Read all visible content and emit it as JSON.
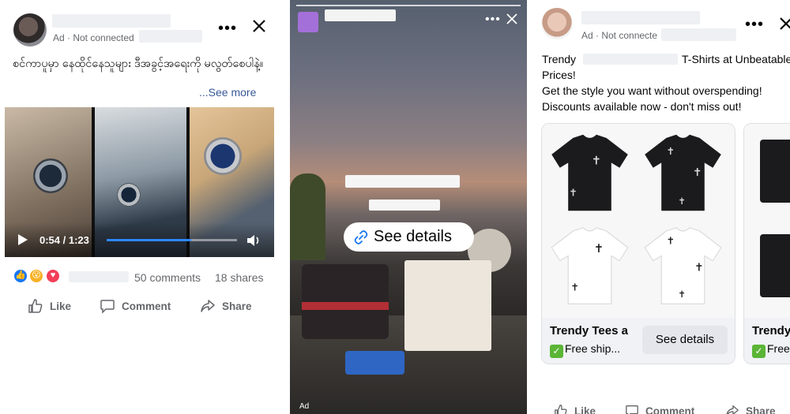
{
  "left_post": {
    "ad_label": "Ad · Not connected",
    "caption": "စင်ကာပူမှာ နေထိုင်နေသူများ ဒီအခွင့်အရေးကို မလွတ်စေပါနဲ့။",
    "see_more": "...See more",
    "video": {
      "time": "0:54 / 1:23",
      "progress": 0.65
    },
    "comments": "50 comments",
    "shares": "18 shares",
    "actions": {
      "like": "Like",
      "comment": "Comment",
      "share": "Share"
    }
  },
  "story": {
    "cta": "See details",
    "ad_label": "Ad"
  },
  "right_post": {
    "ad_label": "Ad · Not connecte",
    "line1_start": "Trendy",
    "line1_end": "T-Shirts at Unbeatable",
    "line2": "Prices!",
    "line3": "Get the style you want without overspending!",
    "line4": "Discounts available now - don't miss out!",
    "cards": [
      {
        "title": "Trendy Tees a",
        "subtitle": "Free ship...",
        "button": "See details"
      },
      {
        "title": "Trendy",
        "subtitle": "Free"
      }
    ],
    "actions": {
      "like": "Like",
      "comment": "Comment",
      "share": "Share"
    }
  },
  "colors": {
    "link": "#385898",
    "progress": "#2d88ff",
    "check": "#5bb537"
  }
}
